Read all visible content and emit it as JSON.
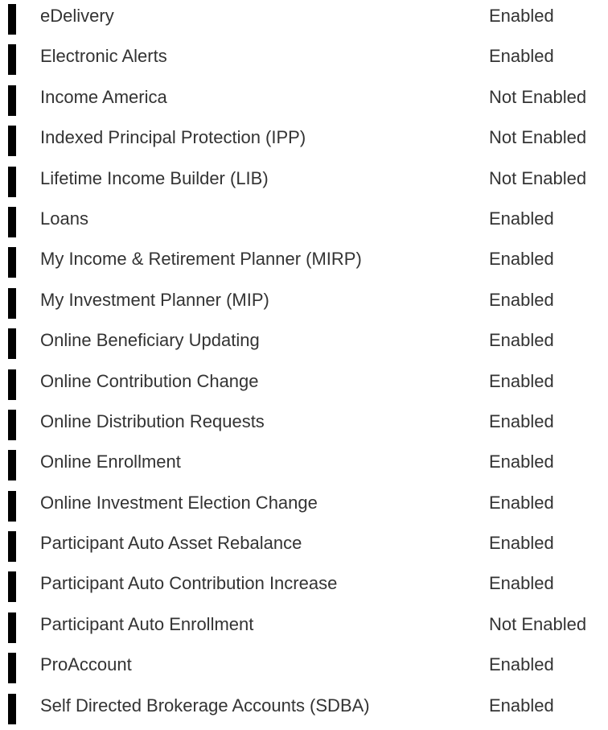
{
  "features": [
    {
      "name": "eDelivery",
      "status": "Enabled"
    },
    {
      "name": "Electronic Alerts",
      "status": "Enabled"
    },
    {
      "name": "Income America",
      "status": "Not Enabled"
    },
    {
      "name": "Indexed Principal Protection (IPP)",
      "status": "Not Enabled"
    },
    {
      "name": "Lifetime Income Builder (LIB)",
      "status": "Not Enabled"
    },
    {
      "name": "Loans",
      "status": "Enabled"
    },
    {
      "name": "My Income & Retirement Planner (MIRP)",
      "status": "Enabled"
    },
    {
      "name": "My Investment Planner (MIP)",
      "status": "Enabled"
    },
    {
      "name": "Online Beneficiary Updating",
      "status": "Enabled"
    },
    {
      "name": "Online Contribution Change",
      "status": "Enabled"
    },
    {
      "name": "Online Distribution Requests",
      "status": "Enabled"
    },
    {
      "name": "Online Enrollment",
      "status": "Enabled"
    },
    {
      "name": "Online Investment Election Change",
      "status": "Enabled"
    },
    {
      "name": "Participant Auto Asset Rebalance",
      "status": "Enabled"
    },
    {
      "name": "Participant Auto Contribution Increase",
      "status": "Enabled"
    },
    {
      "name": "Participant Auto Enrollment",
      "status": "Not Enabled"
    },
    {
      "name": "ProAccount",
      "status": "Enabled"
    },
    {
      "name": "Self Directed Brokerage Accounts (SDBA)",
      "status": "Enabled"
    }
  ],
  "colors": {
    "text": "#333333",
    "marker": "#000000",
    "background": "#ffffff"
  }
}
